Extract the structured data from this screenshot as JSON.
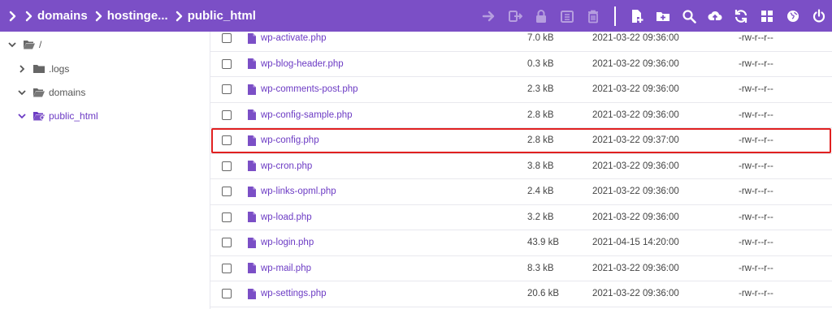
{
  "breadcrumb": {
    "items": [
      {
        "label": ""
      },
      {
        "label": "domains"
      },
      {
        "label": "hostinge..."
      },
      {
        "label": "public_html"
      }
    ]
  },
  "toolbar": {
    "icons": [
      "move-icon",
      "rename-icon",
      "lock-icon",
      "archive-icon",
      "delete-icon",
      "new-file-icon",
      "new-folder-icon",
      "search-icon",
      "upload-icon",
      "refresh-icon",
      "grid-icon",
      "web-icon",
      "power-icon"
    ]
  },
  "sidebar": {
    "items": [
      {
        "label": "/",
        "expanded": true
      },
      {
        "label": ".logs",
        "expanded": false
      },
      {
        "label": "domains",
        "expanded": true
      },
      {
        "label": "public_html",
        "expanded": true,
        "active": true
      }
    ]
  },
  "files": [
    {
      "name": "wp-activate.php",
      "size": "7.0 kB",
      "date": "2021-03-22 09:36:00",
      "perm": "-rw-r--r--"
    },
    {
      "name": "wp-blog-header.php",
      "size": "0.3 kB",
      "date": "2021-03-22 09:36:00",
      "perm": "-rw-r--r--"
    },
    {
      "name": "wp-comments-post.php",
      "size": "2.3 kB",
      "date": "2021-03-22 09:36:00",
      "perm": "-rw-r--r--"
    },
    {
      "name": "wp-config-sample.php",
      "size": "2.8 kB",
      "date": "2021-03-22 09:36:00",
      "perm": "-rw-r--r--"
    },
    {
      "name": "wp-config.php",
      "size": "2.8 kB",
      "date": "2021-03-22 09:37:00",
      "perm": "-rw-r--r--"
    },
    {
      "name": "wp-cron.php",
      "size": "3.8 kB",
      "date": "2021-03-22 09:36:00",
      "perm": "-rw-r--r--"
    },
    {
      "name": "wp-links-opml.php",
      "size": "2.4 kB",
      "date": "2021-03-22 09:36:00",
      "perm": "-rw-r--r--"
    },
    {
      "name": "wp-load.php",
      "size": "3.2 kB",
      "date": "2021-03-22 09:36:00",
      "perm": "-rw-r--r--"
    },
    {
      "name": "wp-login.php",
      "size": "43.9 kB",
      "date": "2021-04-15 14:20:00",
      "perm": "-rw-r--r--"
    },
    {
      "name": "wp-mail.php",
      "size": "8.3 kB",
      "date": "2021-03-22 09:36:00",
      "perm": "-rw-r--r--"
    },
    {
      "name": "wp-settings.php",
      "size": "20.6 kB",
      "date": "2021-03-22 09:36:00",
      "perm": "-rw-r--r--"
    }
  ],
  "colors": {
    "accent": "#7b4fc6",
    "link": "#6c3bc4",
    "highlight": "#e02020"
  }
}
